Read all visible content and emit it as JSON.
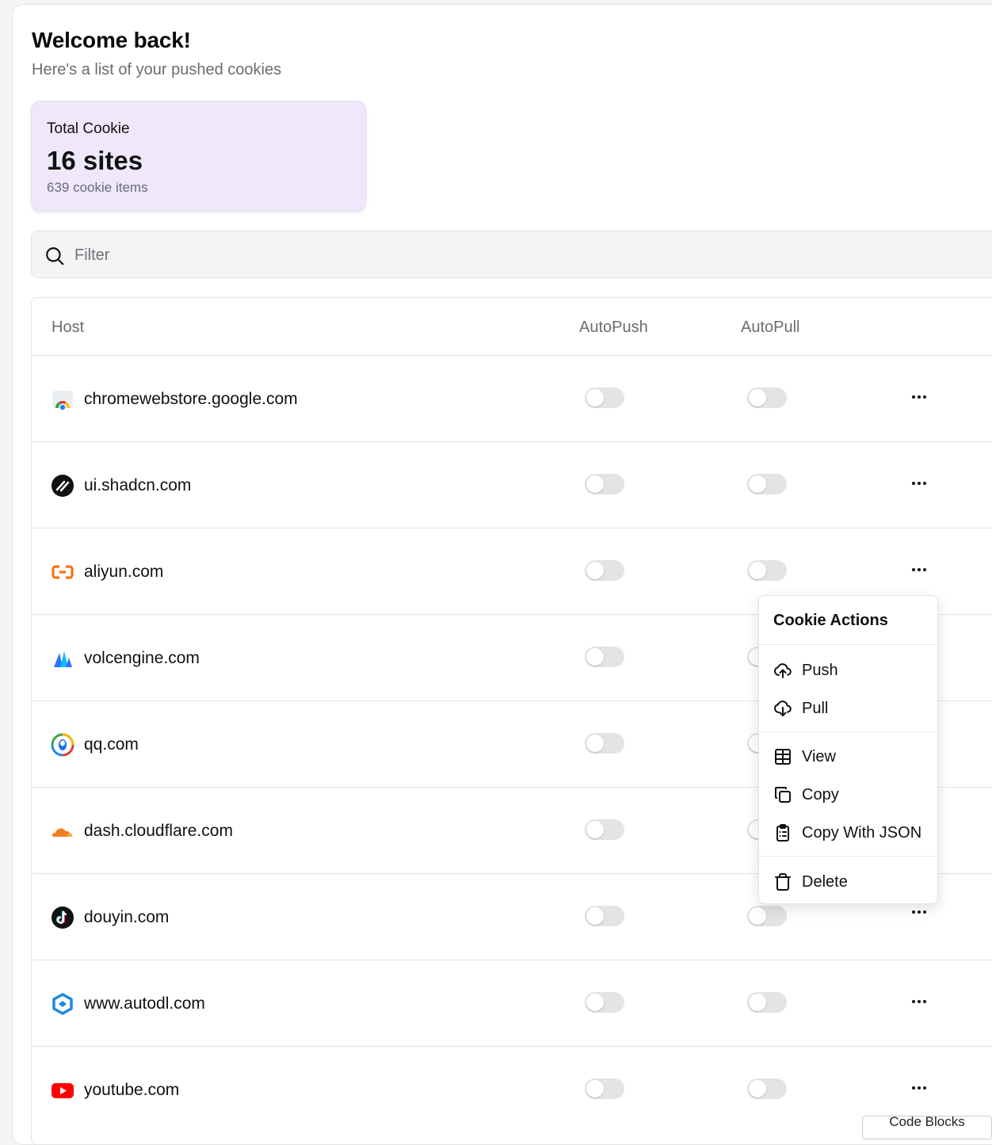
{
  "header": {
    "title": "Welcome back!",
    "subtitle": "Here's a list of your pushed cookies"
  },
  "stats": {
    "title": "Total Cookie",
    "value": "16 sites",
    "sub": "639 cookie items"
  },
  "filter": {
    "placeholder": "Filter",
    "value": ""
  },
  "table": {
    "headers": {
      "host": "Host",
      "autopush": "AutoPush",
      "autopull": "AutoPull"
    },
    "rows": [
      {
        "host": "chromewebstore.google.com",
        "icon": "chrome-web-store-icon",
        "autopush": false,
        "autopull": false
      },
      {
        "host": "ui.shadcn.com",
        "icon": "shadcn-icon",
        "autopush": false,
        "autopull": false
      },
      {
        "host": "aliyun.com",
        "icon": "aliyun-icon",
        "autopush": false,
        "autopull": false
      },
      {
        "host": "volcengine.com",
        "icon": "volcengine-icon",
        "autopush": false,
        "autopull": false
      },
      {
        "host": "qq.com",
        "icon": "qq-icon",
        "autopush": false,
        "autopull": false
      },
      {
        "host": "dash.cloudflare.com",
        "icon": "cloudflare-icon",
        "autopush": false,
        "autopull": false
      },
      {
        "host": "douyin.com",
        "icon": "douyin-icon",
        "autopush": false,
        "autopull": false
      },
      {
        "host": "www.autodl.com",
        "icon": "autodl-icon",
        "autopush": false,
        "autopull": false
      },
      {
        "host": "youtube.com",
        "icon": "youtube-icon",
        "autopush": false,
        "autopull": false
      }
    ]
  },
  "menu": {
    "title": "Cookie Actions",
    "items": [
      {
        "label": "Push",
        "icon": "cloud-upload-icon"
      },
      {
        "label": "Pull",
        "icon": "cloud-download-icon"
      },
      {
        "label": "View",
        "icon": "table-icon"
      },
      {
        "label": "Copy",
        "icon": "copy-icon"
      },
      {
        "label": "Copy With JSON",
        "icon": "clipboard-list-icon"
      },
      {
        "label": "Delete",
        "icon": "trash-icon"
      }
    ]
  },
  "overlay": {
    "codeblocks_label": "Code Blocks"
  },
  "colors": {
    "stat_card_bg": "#efe8fb",
    "toggle_off": "#e4e4e7",
    "muted_text": "#6b6b73"
  }
}
